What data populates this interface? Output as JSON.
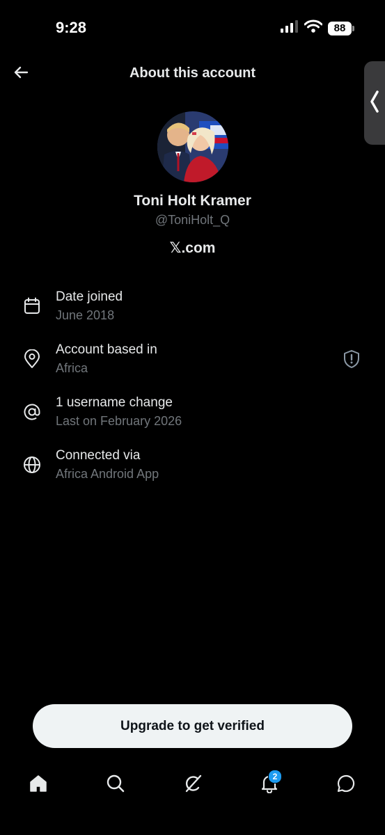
{
  "status_bar": {
    "time": "9:28",
    "battery": "88"
  },
  "header": {
    "title": "About this account"
  },
  "profile": {
    "name": "Toni Holt Kramer",
    "handle": "@ToniHolt_Q",
    "site": "𝕏.com"
  },
  "info": [
    {
      "icon": "calendar-icon",
      "title": "Date joined",
      "subtitle": "June 2018"
    },
    {
      "icon": "location-pin-icon",
      "title": "Account based in",
      "subtitle": "Africa"
    },
    {
      "icon": "at-sign-icon",
      "title": "1 username change",
      "subtitle": "Last on February 2026"
    },
    {
      "icon": "globe-icon",
      "title": "Connected via",
      "subtitle": "Africa Android App"
    }
  ],
  "upgrade": {
    "label": "Upgrade to get verified"
  },
  "nav": {
    "items": [
      "home-icon",
      "search-icon",
      "grok-icon",
      "notifications-icon",
      "messages-icon"
    ],
    "notifications_badge": "2"
  },
  "colors": {
    "background": "#000000",
    "text": "#e7e9ea",
    "muted": "#71767b",
    "accent": "#1d9bf0"
  }
}
